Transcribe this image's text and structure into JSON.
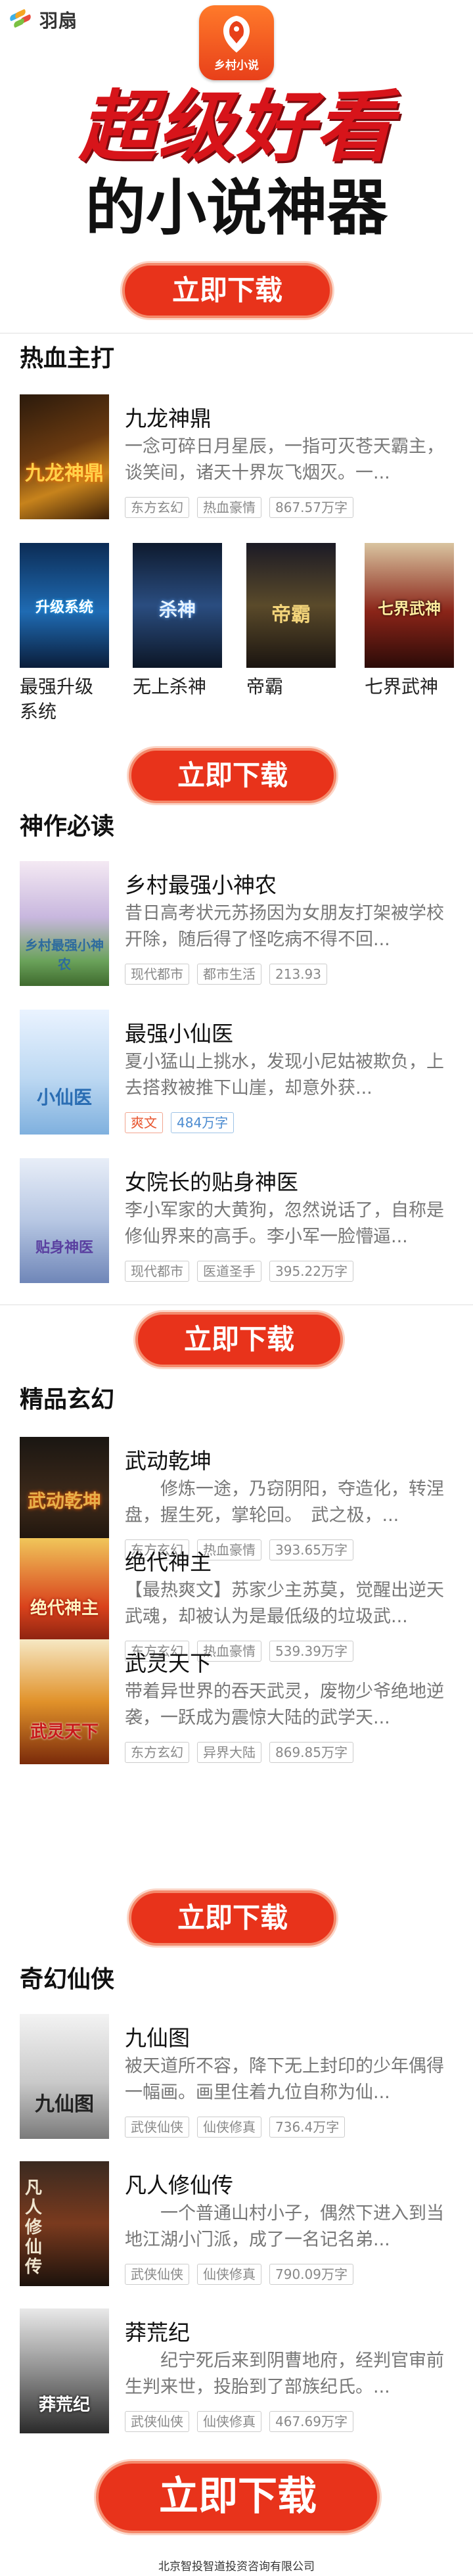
{
  "brand": {
    "name": "羽扇",
    "app_label": "乡村小说"
  },
  "hero": {
    "line1": "超级好看",
    "line2": "的小说神器"
  },
  "download_label": "立即下载",
  "sections": {
    "s1": {
      "title": "热血主打",
      "featured": {
        "title": "九龙神鼎",
        "desc": "一念可碎日月星辰，一指可灭苍天霸主，谈笑间，诸天十界灰飞烟灭。一...",
        "tags": [
          "东方玄幻",
          "热血豪情",
          "867.57万字"
        ]
      },
      "grid": [
        {
          "name": "最强升级系统"
        },
        {
          "name": "无上杀神"
        },
        {
          "name": "帝霸"
        },
        {
          "name": "七界武神"
        }
      ]
    },
    "s2": {
      "title": "神作必读",
      "items": [
        {
          "title": "乡村最强小神农",
          "desc": "昔日高考状元苏扬因为女朋友打架被学校开除，随后得了怪吃病不得不回...",
          "tags": [
            "现代都市",
            "都市生活",
            "213.93"
          ]
        },
        {
          "title": "最强小仙医",
          "desc": "夏小猛山上挑水，发现小尼姑被欺负，上去搭救被推下山崖，却意外获...",
          "tags": [
            "爽文",
            "484万字"
          ]
        },
        {
          "title": "女院长的贴身神医",
          "desc": "李小军家的大黄狗，忽然说话了，自称是修仙界来的高手。李小军一脸懵逼...",
          "tags": [
            "现代都市",
            "医道圣手",
            "395.22万字"
          ]
        }
      ]
    },
    "s3": {
      "title": "精品玄幻",
      "items": [
        {
          "title": "武动乾坤",
          "desc": "　　修炼一途，乃窃阴阳，夺造化，转涅盘，握生死，掌轮回。　武之极，...",
          "tags": [
            "东方玄幻",
            "热血豪情",
            "393.65万字"
          ]
        },
        {
          "title": "绝代神主",
          "desc": "【最热爽文】苏家少主苏莫，觉醒出逆天武魂，却被认为是最低级的垃圾武...",
          "tags": [
            "东方玄幻",
            "热血豪情",
            "539.39万字"
          ]
        },
        {
          "title": "武灵天下",
          "desc": "带着异世界的吞天武灵，废物少爷绝地逆袭，一跃成为震惊大陆的武学天...",
          "tags": [
            "东方玄幻",
            "异界大陆",
            "869.85万字"
          ]
        }
      ]
    },
    "s4": {
      "title": "奇幻仙侠",
      "items": [
        {
          "title": "九仙图",
          "desc": "被天道所不容，降下无上封印的少年偶得一幅画。画里住着九位自称为仙...",
          "tags": [
            "武侠仙侠",
            "仙侠修真",
            "736.4万字"
          ]
        },
        {
          "title": "凡人修仙传",
          "desc": "　　一个普通山村小子，偶然下进入到当地江湖小门派，成了一名记名弟...",
          "tags": [
            "武侠仙侠",
            "仙侠修真",
            "790.09万字"
          ]
        },
        {
          "title": "莽荒纪",
          "desc": "　　纪宁死后来到阴曹地府，经判官审前生判来世，投胎到了部族纪氏。...",
          "tags": [
            "武侠仙侠",
            "仙侠修真",
            "467.69万字"
          ]
        }
      ]
    }
  },
  "cover_text": {
    "s1_featured": "九龙神鼎",
    "g1": "升级系统",
    "g2": "杀神",
    "g3": "帝霸",
    "g4": "七界武神",
    "s2_0": "乡村最强小神农",
    "s2_1": "小仙医",
    "s2_2": "贴身神医",
    "s3_0": "武动乾坤",
    "s3_1": "绝代神主",
    "s3_2": "武灵天下",
    "s4_0": "九仙图",
    "s4_1": "凡人修仙传",
    "s4_2": "莽荒纪"
  },
  "footer": "北京智投智道投资咨询有限公司",
  "colors": {
    "accent": "#e8331b",
    "hero_red": "#d7141a"
  }
}
